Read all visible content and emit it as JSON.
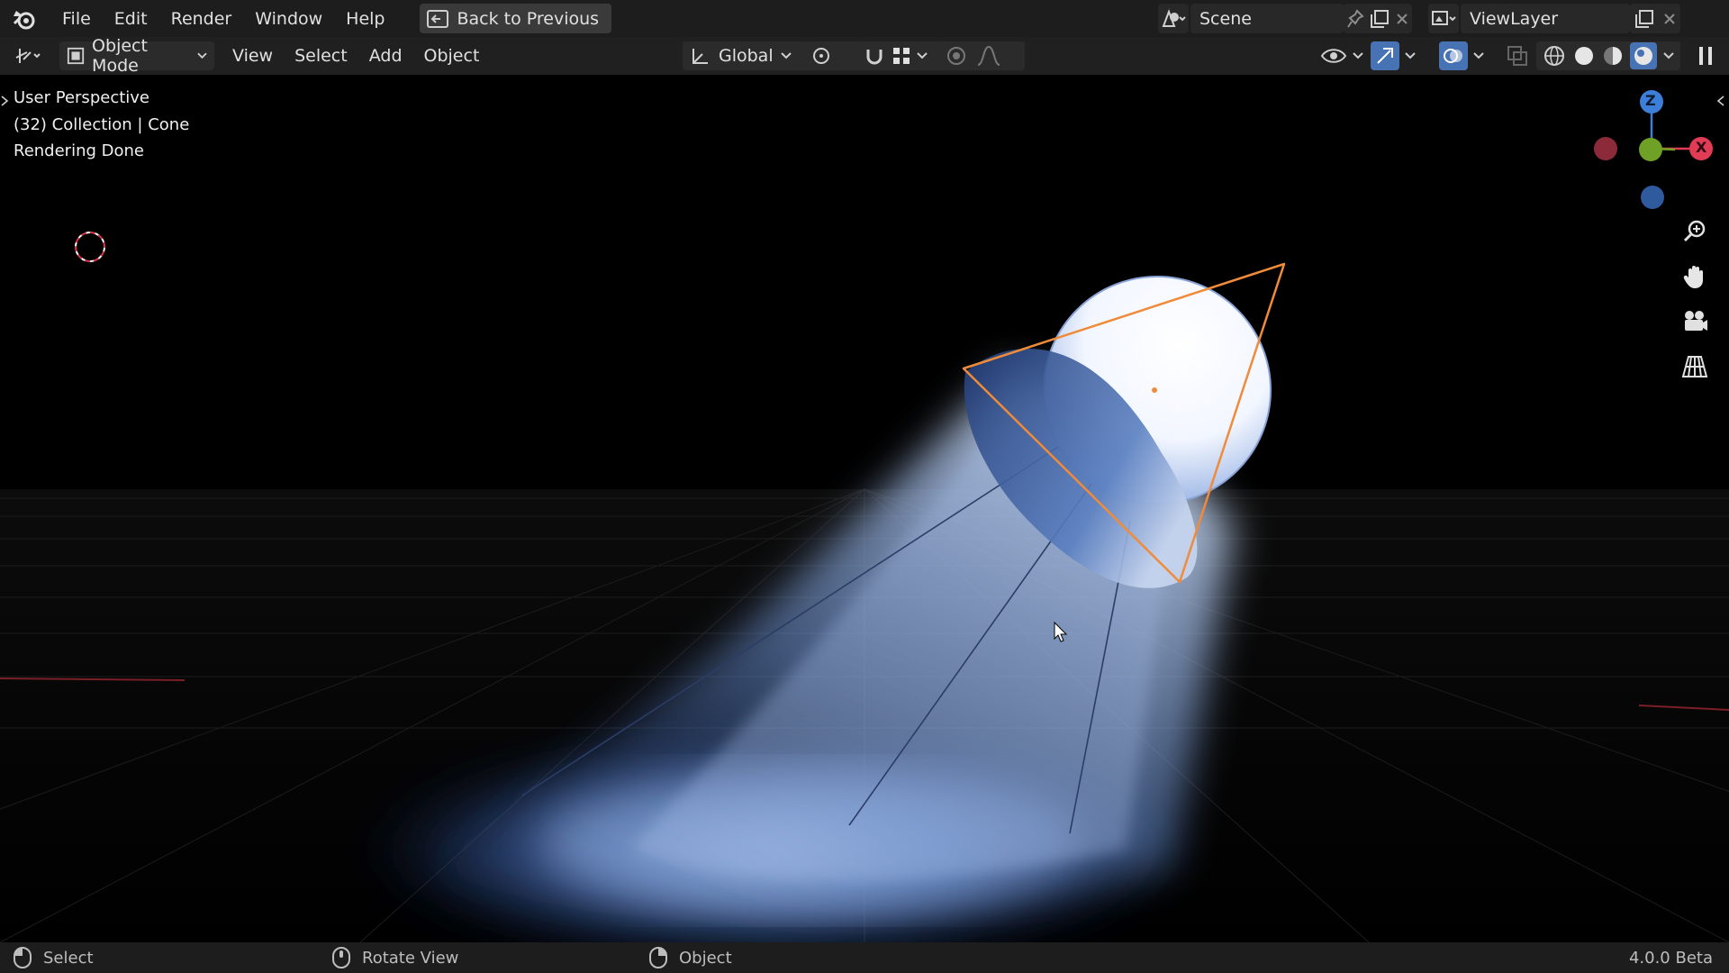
{
  "topbar": {
    "menus": [
      "File",
      "Edit",
      "Render",
      "Window",
      "Help"
    ],
    "back_button": "Back to Previous",
    "scene": "Scene",
    "view_layer": "ViewLayer"
  },
  "header": {
    "mode": "Object Mode",
    "menus": [
      "View",
      "Select",
      "Add",
      "Object"
    ],
    "orientation": "Global"
  },
  "viewport": {
    "perspective": "User Perspective",
    "collection_info": "(32) Collection | Cone",
    "render_status": "Rendering Done",
    "gizmo": {
      "z_label": "Z",
      "x_label": "X"
    }
  },
  "statusbar": {
    "select": "Select",
    "rotate": "Rotate View",
    "object": "Object",
    "version": "4.0.0 Beta"
  },
  "colors": {
    "accent": "#4772b3",
    "axis_x": "#e23b55",
    "axis_y": "#6ea126",
    "axis_z": "#3d7ed8",
    "selection": "#f08b3a"
  }
}
